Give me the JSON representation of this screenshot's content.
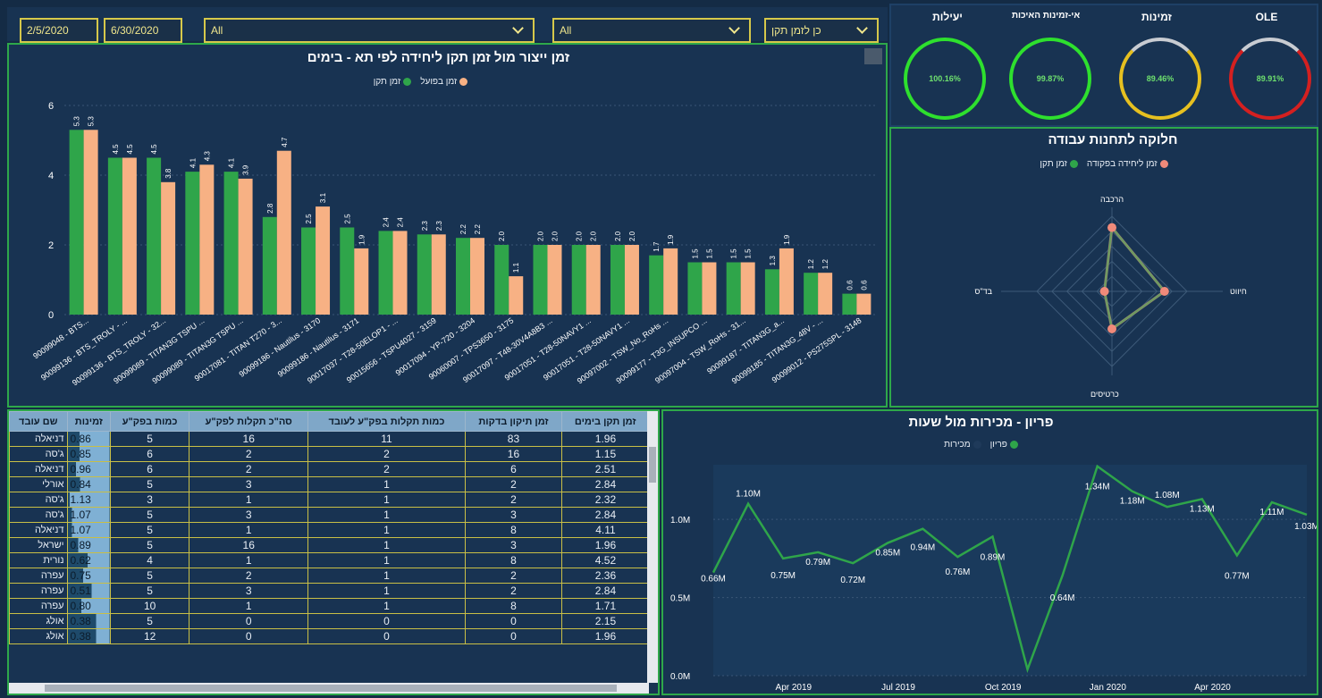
{
  "filters": {
    "start_date": "2/5/2020",
    "end_date": "6/30/2020",
    "filter1": "All",
    "filter2": "All",
    "filter3": "כן לזמן תקן"
  },
  "kpis": [
    {
      "label": "OLE",
      "value": "89.91%",
      "color": "#d42020"
    },
    {
      "label": "זמינות",
      "value": "89.46%",
      "color": "#e6c020"
    },
    {
      "label": "אי-זמינות האיכות",
      "value": "99.87%",
      "color": "#2ee02e"
    },
    {
      "label": "יעילות",
      "value": "100.16%",
      "color": "#2ee02e"
    }
  ],
  "bar_chart": {
    "title": "זמן ייצור  מול זמן תקן ליחידה לפי תא - בימים",
    "legend_actual": "זמן בפועל",
    "legend_standard": "זמן תקן",
    "y_ticks": [
      "0",
      "2",
      "4",
      "6"
    ],
    "colors": {
      "standard": "#2fa54a",
      "actual": "#f7b184"
    }
  },
  "chart_data": [
    {
      "type": "bar",
      "title": "זמן ייצור  מול זמן תקן ליחידה לפי תא - בימים",
      "categories": [
        "90099048 - BTS...",
        "90099136 - BTS_TROLY - ...",
        "90099136 - BTS_TROLY - 32...",
        "90099089 - TITAN3G TSPU ...",
        "90099089 - TITAN3G TSPU ...",
        "90017081 - TITAN T270 - 3...",
        "90099186 - Nautilus - 3170",
        "90099186 - Nautilus - 3171",
        "90017037 - T28-50ELOP1 - ...",
        "90015656 - TSPU4027 - 3159",
        "90017094 - YP-720 - 3204",
        "90060007 - TPS3650 - 3175",
        "90017097 - T48-30V4A8B3 ...",
        "90017051 - T28-50NAVY1 ...",
        "90017051 - T28-50NAVY1 ...",
        "90097002 - TSW_No_RoHs ...",
        "90099177 - T3G_INSUPCO ...",
        "90097004 - TSW_RoHs - 31...",
        "90099187 - TITAN3G_a...",
        "90099185 - TITAN3G_48V - ...",
        "90099012 - PS275SPL - 3148"
      ],
      "series": [
        {
          "name": "זמן תקן",
          "values": [
            5.3,
            4.5,
            4.5,
            4.1,
            4.1,
            2.8,
            2.5,
            2.5,
            2.4,
            2.3,
            2.2,
            2.0,
            2.0,
            2.0,
            2.0,
            1.7,
            1.5,
            1.5,
            1.3,
            1.2,
            0.6
          ]
        },
        {
          "name": "זמן בפועל",
          "values": [
            5.3,
            4.5,
            3.8,
            4.3,
            3.9,
            4.7,
            3.1,
            1.9,
            2.4,
            2.3,
            2.2,
            1.1,
            2.0,
            2.0,
            2.0,
            1.9,
            1.5,
            1.5,
            1.9,
            1.2,
            0.6
          ]
        }
      ],
      "ylim": [
        0,
        6
      ]
    },
    {
      "type": "radar",
      "title": "חלוקה לתחנות עבודה",
      "categories": [
        "הרכבה",
        "חיווט",
        "כרטיסים",
        "בד\"ס"
      ],
      "series": [
        {
          "name": "זמן ליחידה בפקודה",
          "values": [
            0.85,
            0.7,
            0.5,
            0.1
          ]
        },
        {
          "name": "זמן תקן",
          "values": [
            0.85,
            0.7,
            0.5,
            0.1
          ]
        }
      ]
    },
    {
      "type": "line",
      "title": "פריון - מכירות מול שעות",
      "x": [
        "Feb 2019",
        "Mar 2019",
        "Apr 2019",
        "May 2019",
        "Jun 2019",
        "Jul 2019",
        "Aug 2019",
        "Sep 2019",
        "Oct 2019",
        "Nov 2019",
        "Dec 2019",
        "Jan 2020",
        "Feb 2020",
        "Mar 2020",
        "Apr 2020",
        "May 2020",
        "Jun 2020"
      ],
      "series": [
        {
          "name": "פריון",
          "values": [
            0.66,
            1.1,
            0.75,
            0.79,
            0.72,
            0.85,
            0.94,
            0.76,
            0.89,
            0.04,
            0.64,
            1.34,
            1.18,
            1.08,
            1.13,
            0.77,
            1.11,
            1.03
          ]
        }
      ],
      "point_labels": [
        "0.66M",
        "1.10M",
        "0.75M",
        "0.79M",
        "0.72M",
        "0.85M",
        "0.94M",
        "0.76M",
        "0.89M",
        "",
        "0.64M",
        "1.34M",
        "1.18M",
        "1.08M",
        "1.13M",
        "0.77M",
        "1.11M",
        "1.03M"
      ],
      "y_ticks": [
        "0.0M",
        "0.5M",
        "1.0M"
      ],
      "x_ticks": [
        "Apr 2019",
        "Jul 2019",
        "Oct 2019",
        "Jan 2020",
        "Apr 2020"
      ],
      "ylim": [
        0,
        1.35
      ]
    }
  ],
  "radar": {
    "title": "חלוקה לתחנות עבודה",
    "legend_a": "זמן ליחידה בפקודה",
    "legend_b": "זמן תקן",
    "axis_top": "הרכבה",
    "axis_right": "חיווט",
    "axis_bottom": "כרטיסים",
    "axis_left": "בד\"ס"
  },
  "line_chart": {
    "title": "פריון - מכירות מול שעות",
    "legend_a": "פריון",
    "legend_b": "מכירות"
  },
  "table": {
    "headers": [
      "זמן תקן בימים",
      "זמן תיקון בדקות",
      "כמות תקלות בפק\"ע לעובד",
      "סה\"כ תקלות לפק\"ע",
      "כמות בפק\"ע",
      "זמינות",
      "שם עובד"
    ],
    "rows": [
      [
        "1.96",
        "83",
        "11",
        "16",
        "5",
        "0.86",
        "דניאלה"
      ],
      [
        "1.15",
        "16",
        "2",
        "2",
        "6",
        "0.85",
        "ג'סה"
      ],
      [
        "2.51",
        "6",
        "2",
        "2",
        "6",
        "0.96",
        "דניאלה"
      ],
      [
        "2.84",
        "2",
        "1",
        "3",
        "5",
        "0.84",
        "אורלי"
      ],
      [
        "2.32",
        "2",
        "1",
        "1",
        "3",
        "1.13",
        "ג'סה"
      ],
      [
        "2.84",
        "3",
        "1",
        "3",
        "5",
        "1.07",
        "ג'סה"
      ],
      [
        "4.11",
        "8",
        "1",
        "1",
        "5",
        "1.07",
        "דניאלה"
      ],
      [
        "1.96",
        "3",
        "1",
        "16",
        "5",
        "0.89",
        "ישראל"
      ],
      [
        "4.52",
        "8",
        "1",
        "1",
        "4",
        "0.62",
        "נורית"
      ],
      [
        "2.36",
        "2",
        "1",
        "2",
        "5",
        "0.75",
        "עפרה"
      ],
      [
        "2.84",
        "2",
        "1",
        "3",
        "5",
        "0.51",
        "עפרה"
      ],
      [
        "1.71",
        "8",
        "1",
        "1",
        "10",
        "0.80",
        "עפרה"
      ],
      [
        "2.15",
        "0",
        "0",
        "0",
        "5",
        "0.38",
        "אולג"
      ],
      [
        "1.96",
        "0",
        "0",
        "0",
        "12",
        "0.38",
        "אולג"
      ]
    ]
  }
}
